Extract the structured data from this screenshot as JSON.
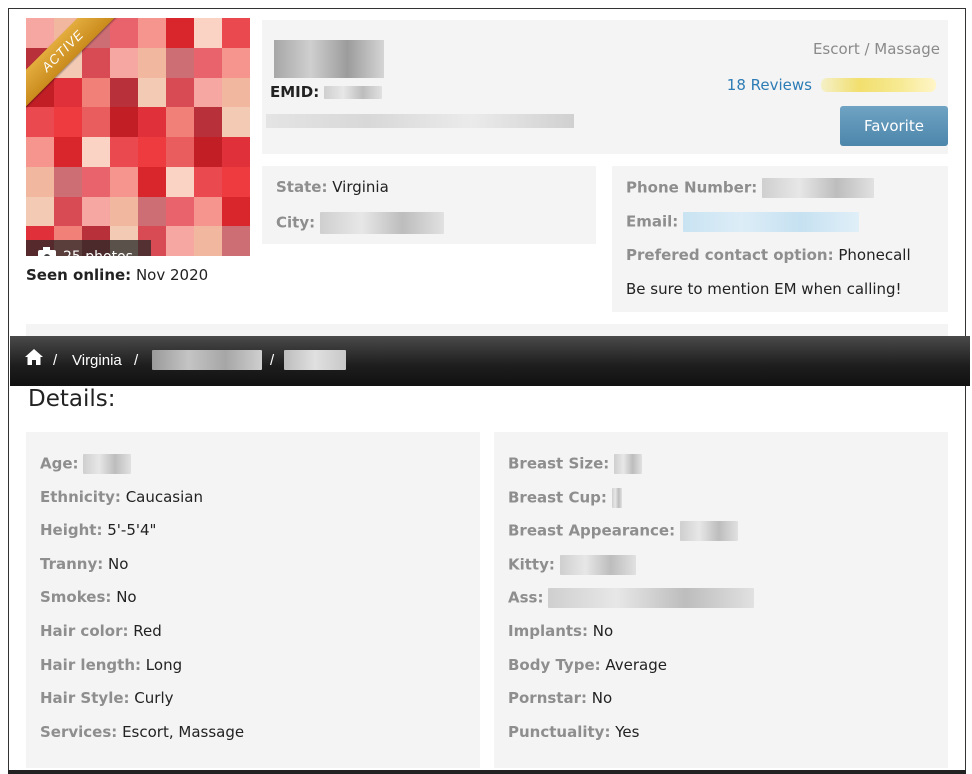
{
  "profile": {
    "status_ribbon": "ACTIVE",
    "photo_count": "25 photos",
    "seen_online_label": "Seen online:",
    "seen_online_value": "Nov 2020",
    "emid_label": "EMID:",
    "category": "Escort / Massage",
    "reviews": "18 Reviews",
    "favorite_label": "Favorite"
  },
  "location": {
    "state_label": "State:",
    "state_value": "Virginia",
    "city_label": "City:"
  },
  "contact": {
    "phone_label": "Phone Number:",
    "email_label": "Email:",
    "preferred_label": "Prefered contact option:",
    "preferred_value": "Phonecall",
    "note": "Be sure to mention EM when calling!"
  },
  "breadcrumb": {
    "sep": "/",
    "state": "Virginia"
  },
  "details": {
    "title": "Details:",
    "left": [
      {
        "label": "Age:",
        "value": ""
      },
      {
        "label": "Ethnicity:",
        "value": "Caucasian"
      },
      {
        "label": "Height:",
        "value": "5'-5'4\""
      },
      {
        "label": "Tranny:",
        "value": "No"
      },
      {
        "label": "Smokes:",
        "value": "No"
      },
      {
        "label": "Hair color:",
        "value": "Red"
      },
      {
        "label": "Hair length:",
        "value": "Long"
      },
      {
        "label": "Hair Style:",
        "value": "Curly"
      },
      {
        "label": "Services:",
        "value": "Escort, Massage"
      }
    ],
    "right": [
      {
        "label": "Breast Size:",
        "value": ""
      },
      {
        "label": "Breast Cup:",
        "value": ""
      },
      {
        "label": "Breast Appearance:",
        "value": ""
      },
      {
        "label": "Kitty:",
        "value": ""
      },
      {
        "label": "Ass:",
        "value": ""
      },
      {
        "label": "Implants:",
        "value": "No"
      },
      {
        "label": "Body Type:",
        "value": "Average"
      },
      {
        "label": "Pornstar:",
        "value": "No"
      },
      {
        "label": "Punctuality:",
        "value": "Yes"
      }
    ]
  },
  "colors": {
    "ribbon": "#d9a033",
    "link": "#2d7cb5",
    "button": "#5a91b5",
    "label": "#8e8e8e",
    "panel": "#f4f4f4"
  }
}
